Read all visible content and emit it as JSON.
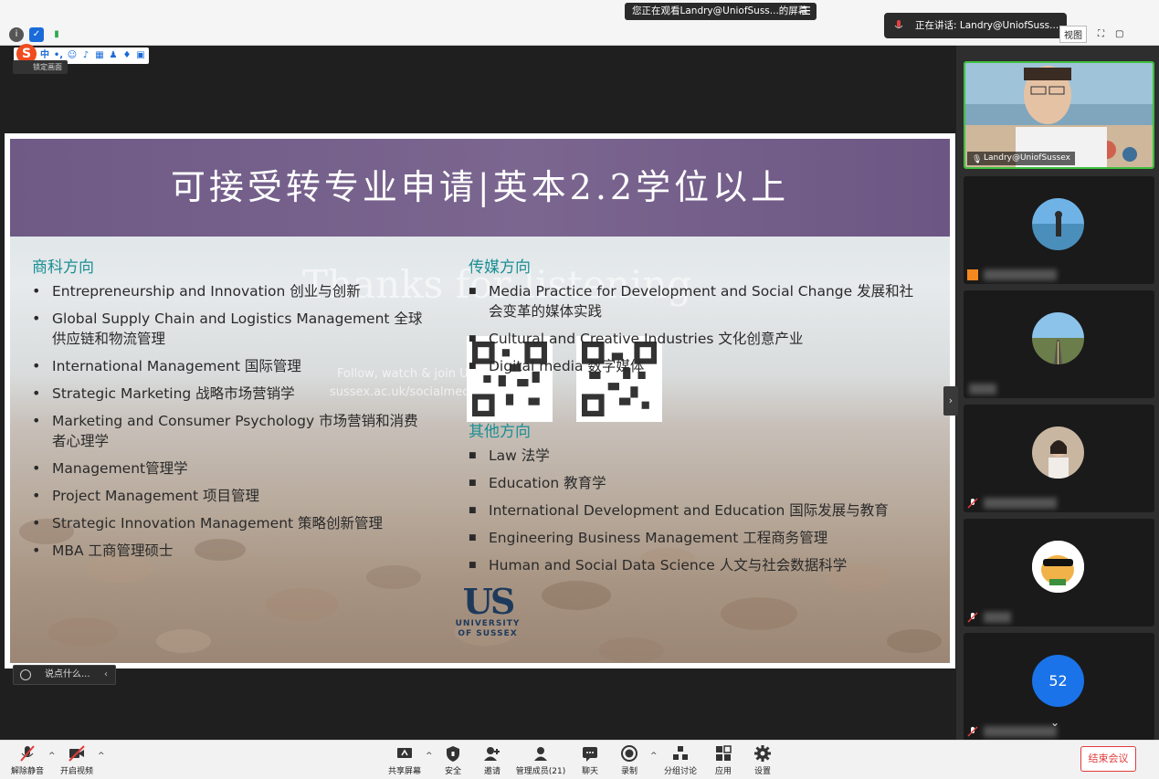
{
  "topbar": {
    "viewing_banner": "您正在观看Landry@UniofSuss...的屏幕",
    "speaking": "正在讲话: Landry@UniofSuss...",
    "view_mode": "视图",
    "lock_label": "锁定画面"
  },
  "slide": {
    "title": "可接受转专业申请|英本2.2学位以上",
    "watermark_heading": "Thanks for listening",
    "watermark_line1": "Follow, watch & join US",
    "watermark_line2": "sussex.ac.uk/socialmedia",
    "left_heading": "商科方向",
    "left_items": [
      "Entrepreneurship and Innovation 创业与创新",
      "Global Supply Chain and Logistics Management 全球供应链和物流管理",
      "International Management 国际管理",
      "Strategic Marketing  战略市场营销学",
      "Marketing and Consumer Psychology 市场营销和消费者心理学",
      "Management管理学",
      "Project Management 项目管理",
      "Strategic Innovation Management 策略创新管理",
      "MBA 工商管理硕士"
    ],
    "media_heading": "传媒方向",
    "media_items": [
      "Media Practice for Development and Social Change 发展和社会变革的媒体实践",
      "Cultural and Creative Industries 文化创意产业",
      "Digital media 数字媒体"
    ],
    "other_heading": "其他方向",
    "other_items": [
      "Law 法学",
      "Education 教育学",
      "International Development and Education 国际发展与教育",
      "Engineering Business Management 工程商务管理",
      "Human and Social Data Science 人文与社会数据科学"
    ],
    "logo_big": "US",
    "logo_line1": "UNIVERSITY",
    "logo_line2": "OF SUSSEX"
  },
  "chat_hint": "说点什么...",
  "gallery": {
    "active_name": "Landry@UniofSussex",
    "count_avatar": "52"
  },
  "toolbar": {
    "unmute": "解除静音",
    "start_video": "开启视频",
    "share_screen": "共享屏幕",
    "security": "安全",
    "invite": "邀请",
    "participants": "管理成员(21)",
    "chat": "聊天",
    "record": "录制",
    "breakout": "分组讨论",
    "apps": "应用",
    "settings": "设置",
    "end_meeting": "结束会议"
  },
  "colors": {
    "accent_teal": "#1a8f93",
    "title_purple": "#735e8a",
    "end_red": "#e03b3b",
    "active_green": "#3fbf3f"
  }
}
